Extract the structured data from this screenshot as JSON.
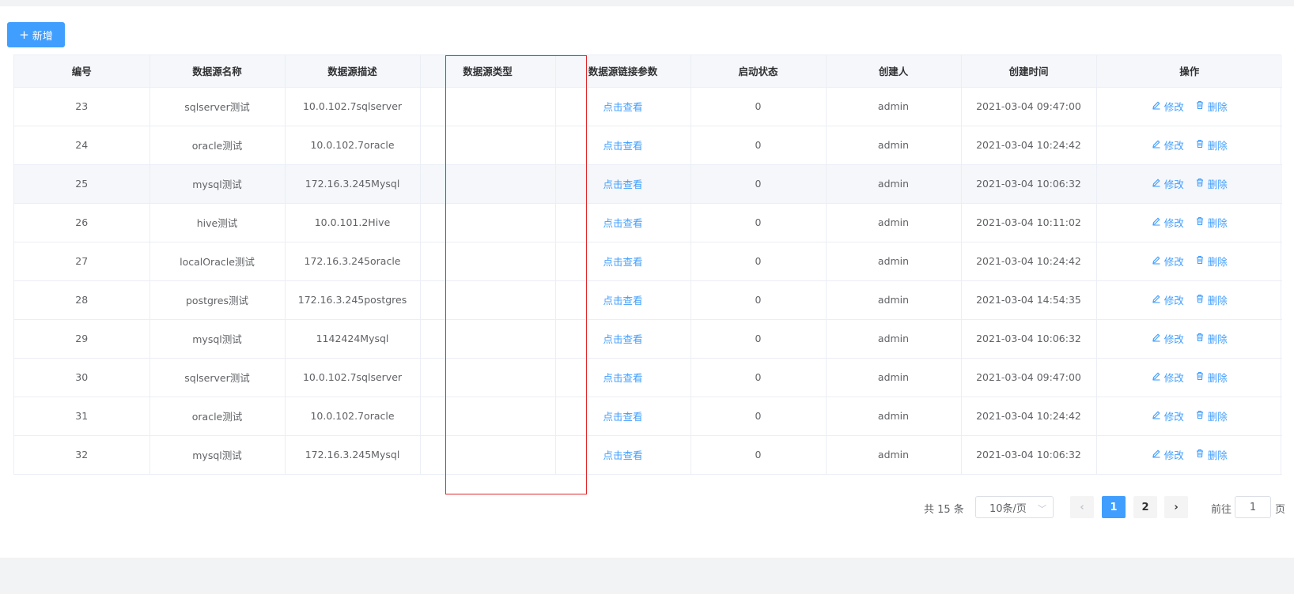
{
  "toolbar": {
    "add_label": "新增",
    "add_icon": "plus-icon"
  },
  "table": {
    "headers": [
      "编号",
      "数据源名称",
      "数据源描述",
      "数据源类型",
      "数据源链接参数",
      "启动状态",
      "创建人",
      "创建时间",
      "操作"
    ],
    "view_label": "点击查看",
    "edit_label": "修改",
    "delete_label": "删除",
    "rows": [
      {
        "id": "23",
        "name": "sqlserver测试",
        "desc": "10.0.102.7sqlserver",
        "type": "",
        "status": "0",
        "creator": "admin",
        "created": "2021-03-04 09:47:00"
      },
      {
        "id": "24",
        "name": "oracle测试",
        "desc": "10.0.102.7oracle",
        "type": "",
        "status": "0",
        "creator": "admin",
        "created": "2021-03-04 10:24:42"
      },
      {
        "id": "25",
        "name": "mysql测试",
        "desc": "172.16.3.245Mysql",
        "type": "",
        "status": "0",
        "creator": "admin",
        "created": "2021-03-04 10:06:32"
      },
      {
        "id": "26",
        "name": "hive测试",
        "desc": "10.0.101.2Hive",
        "type": "",
        "status": "0",
        "creator": "admin",
        "created": "2021-03-04 10:11:02"
      },
      {
        "id": "27",
        "name": "localOracle测试",
        "desc": "172.16.3.245oracle",
        "type": "",
        "status": "0",
        "creator": "admin",
        "created": "2021-03-04 10:24:42"
      },
      {
        "id": "28",
        "name": "postgres测试",
        "desc": "172.16.3.245postgres",
        "type": "",
        "status": "0",
        "creator": "admin",
        "created": "2021-03-04 14:54:35"
      },
      {
        "id": "29",
        "name": "mysql测试",
        "desc": "1142424Mysql",
        "type": "",
        "status": "0",
        "creator": "admin",
        "created": "2021-03-04 10:06:32"
      },
      {
        "id": "30",
        "name": "sqlserver测试",
        "desc": "10.0.102.7sqlserver",
        "type": "",
        "status": "0",
        "creator": "admin",
        "created": "2021-03-04 09:47:00"
      },
      {
        "id": "31",
        "name": "oracle测试",
        "desc": "10.0.102.7oracle",
        "type": "",
        "status": "0",
        "creator": "admin",
        "created": "2021-03-04 10:24:42"
      },
      {
        "id": "32",
        "name": "mysql测试",
        "desc": "172.16.3.245Mysql",
        "type": "",
        "status": "0",
        "creator": "admin",
        "created": "2021-03-04 10:06:32"
      }
    ]
  },
  "pagination": {
    "total_text": "共 15 条",
    "page_size": "10条/页",
    "pages": [
      "1",
      "2"
    ],
    "current_page": "1",
    "goto_label": "前往",
    "goto_value": "1",
    "page_suffix": "页"
  },
  "colors": {
    "primary": "#409eff",
    "highlight_border": "#e0282b"
  }
}
